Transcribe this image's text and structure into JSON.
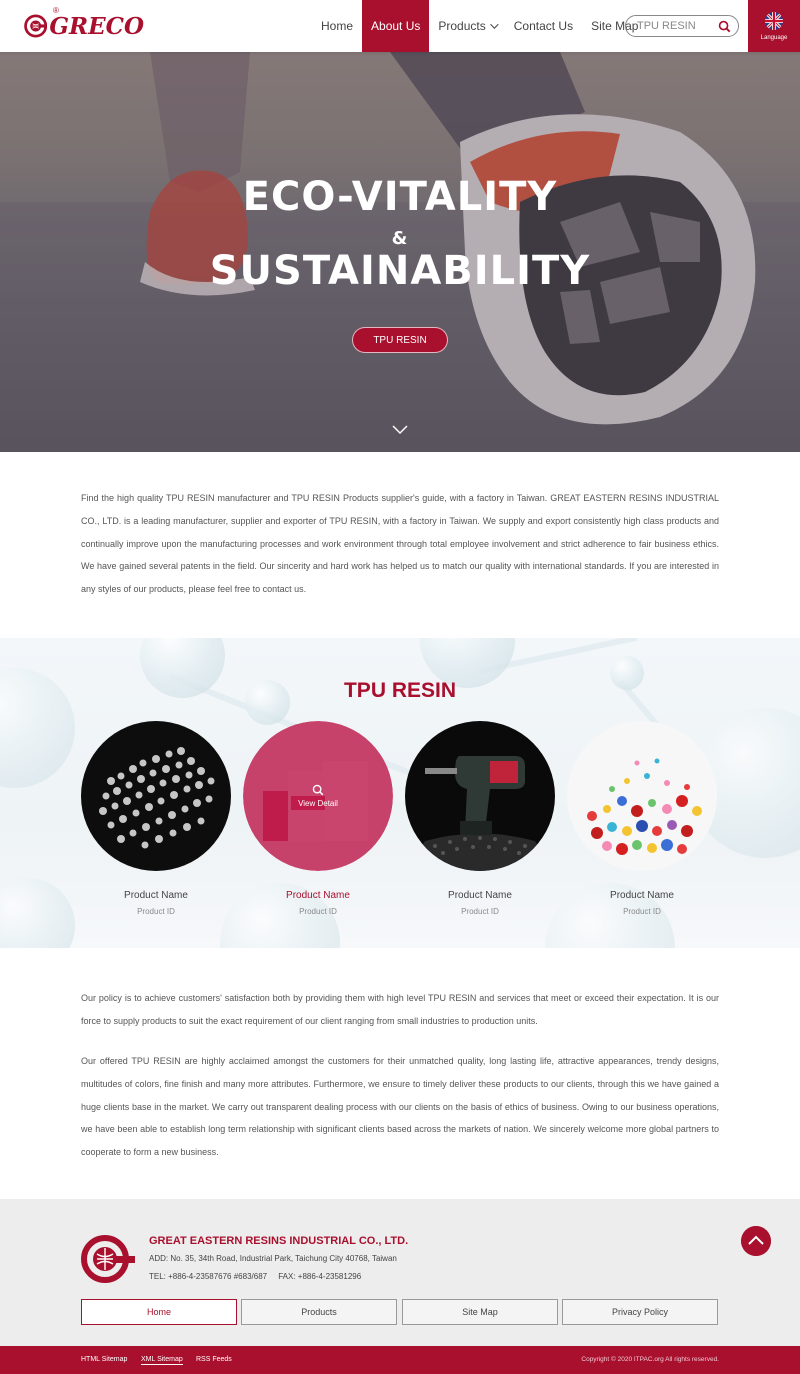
{
  "header": {
    "logo_text": "GRECO",
    "logo_reg": "®",
    "nav": [
      {
        "label": "Home"
      },
      {
        "label": "About Us",
        "active": true
      },
      {
        "label": "Products",
        "has_dropdown": true
      },
      {
        "label": "Contact Us"
      },
      {
        "label": "Site Map"
      }
    ],
    "search": {
      "value": "TPU RESIN",
      "icon": "search-icon"
    },
    "language": {
      "label": "Language",
      "icon": "uk-flag-icon"
    }
  },
  "hero": {
    "line1": "ECO-VITALITY",
    "line2": "&",
    "line3": "SUSTAINABILITY",
    "button": "TPU RESIN",
    "scroll_icon": "chevron-down-icon"
  },
  "intro": {
    "text": "Find the high quality TPU RESIN manufacturer and TPU RESIN Products supplier's guide, with a factory in Taiwan. GREAT EASTERN RESINS INDUSTRIAL CO., LTD. is a leading manufacturer, supplier and exporter of TPU RESIN, with a factory in Taiwan. We supply and export consistently high class products and continually improve upon the manufacturing processes and work environment through total employee involvement and strict adherence to fair business ethics. We have gained several patents in the field. Our sincerity and hard work has helped us to match our quality with international standards. If you are interested in any styles of our products, please feel free to contact us."
  },
  "products": {
    "title": "TPU RESIN",
    "view_detail": "View  Detail",
    "items": [
      {
        "name": "Product Name",
        "id": "Product ID"
      },
      {
        "name": "Product Name",
        "id": "Product ID",
        "highlight": true
      },
      {
        "name": "Product Name",
        "id": "Product ID"
      },
      {
        "name": "Product Name",
        "id": "Product ID"
      }
    ]
  },
  "policy": {
    "p1": "Our policy is to achieve customers' satisfaction both by providing them with high level TPU RESIN and services that meet or exceed their expectation. It is our force to supply products to suit the exact requirement of our client ranging from small industries to production units.",
    "p2": "Our offered TPU RESIN are highly acclaimed amongst the customers for their unmatched quality, long lasting life, attractive appearances, trendy designs, multitudes of colors, fine finish and many more attributes. Furthermore, we ensure to timely deliver these products to our clients, through this we have gained a huge clients base in the market. We carry out transparent dealing process with our clients on the basis of ethics of business. Owing to our business operations, we have been able to establish long term relationship with significant clients based across the markets of nation. We sincerely welcome more global partners to cooperate to form a new business."
  },
  "footer": {
    "company": "GREAT EASTERN RESINS INDUSTRIAL CO., LTD.",
    "address": "ADD: No. 35, 34th Road, Industrial Park, Taichung City 40768, Taiwan",
    "tel": "TEL: +886-4-23587676 #683/687     FAX: +886-4-23581296",
    "nav": [
      "Home",
      "Products",
      "Site Map",
      "Privacy Policy"
    ],
    "bottom_links": [
      "HTML Sitemap",
      "XML Sitemap",
      "RSS Feeds"
    ],
    "copyright": "Copyright © 2020 ITPAC.org All rights reserved.",
    "brand_color": "#a8102e"
  }
}
